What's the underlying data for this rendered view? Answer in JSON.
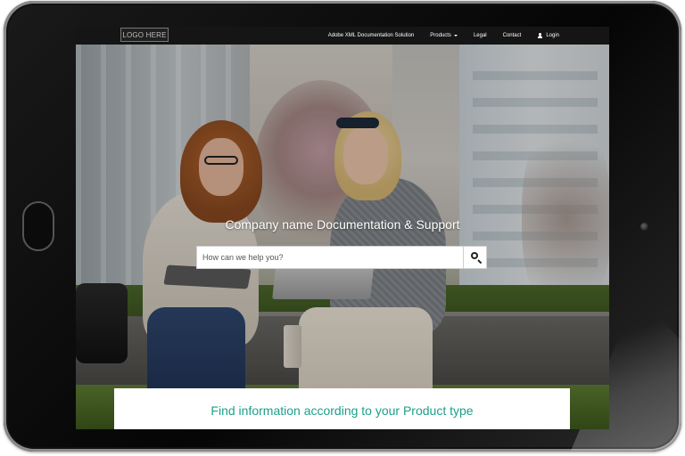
{
  "navbar": {
    "logo": "LOGO HERE",
    "links": [
      {
        "label": "Adobe XML Documentation Solution"
      },
      {
        "label": "Products",
        "has_dropdown": true
      },
      {
        "label": "Legal"
      },
      {
        "label": "Contact"
      },
      {
        "label": "Login",
        "icon": "user-icon"
      }
    ]
  },
  "hero": {
    "title": "Company name Documentation & Support",
    "search": {
      "placeholder": "How can we help you?",
      "button_icon": "search-icon"
    }
  },
  "info_panel": {
    "heading": "Find information according to your Product type",
    "accent_color": "#1e9f8a"
  }
}
